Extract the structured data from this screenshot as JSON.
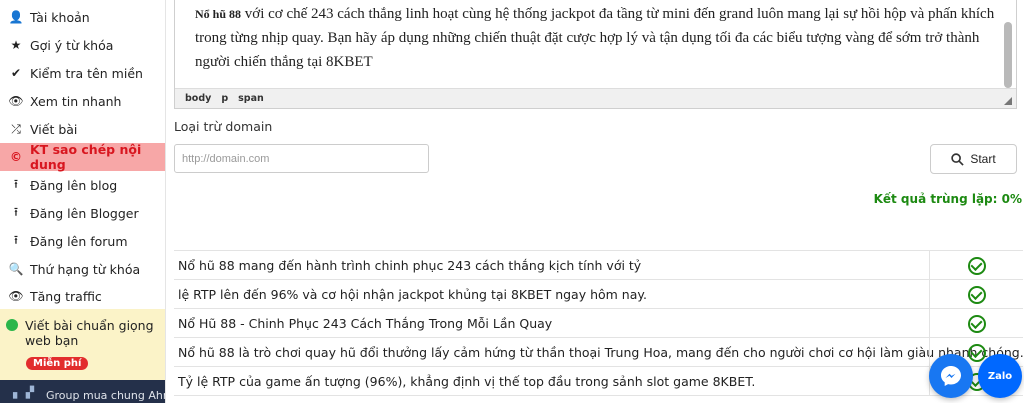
{
  "sidebar": {
    "items": [
      {
        "label": "Tài khoản",
        "icon": "user-icon",
        "glyph": "👤"
      },
      {
        "label": "Gợi ý từ khóa",
        "icon": "star-icon",
        "glyph": "★"
      },
      {
        "label": "Kiểm tra tên miền",
        "icon": "check-icon",
        "glyph": "✔"
      },
      {
        "label": "Xem tin nhanh",
        "icon": "eye-icon",
        "glyph": "👁"
      },
      {
        "label": "Viết bài",
        "icon": "shuffle-icon",
        "glyph": "⤮"
      },
      {
        "label": "KT sao chép nội dung",
        "icon": "copyright-icon",
        "glyph": "©"
      },
      {
        "label": "Đăng lên blog",
        "icon": "upload-icon",
        "glyph": "⭱"
      },
      {
        "label": "Đăng lên Blogger",
        "icon": "upload-icon",
        "glyph": "⭱"
      },
      {
        "label": "Đăng lên forum",
        "icon": "upload-icon",
        "glyph": "⭱"
      },
      {
        "label": "Thứ hạng từ khóa",
        "icon": "search-icon",
        "glyph": "🔍"
      },
      {
        "label": "Tăng traffic",
        "icon": "eye-icon",
        "glyph": "👁"
      }
    ],
    "promo": {
      "text": "Viết bài chuẩn giọng web bạn",
      "badge": "Miễn phí"
    },
    "group_text": "Group mua chung Ahre"
  },
  "editor": {
    "bold_lead": "Nổ hũ 88",
    "body": " với cơ chế 243 cách thắng linh hoạt cùng hệ thống jackpot đa tầng từ mini đến grand luôn mang lại sự hồi hộp và phấn khích trong từng nhịp quay. Bạn hãy áp dụng những chiến thuật đặt cược hợp lý và tận dụng tối đa các biểu tượng vàng để sớm trở thành người chiến thắng tại 8KBET",
    "status_path": [
      "body",
      "p",
      "span"
    ]
  },
  "exclude": {
    "label": "Loại trừ domain",
    "placeholder": "http://domain.com"
  },
  "start_button": {
    "label": "Start"
  },
  "result": {
    "label": "Kết quả trùng lặp: 0%"
  },
  "rows": [
    "Nổ hũ 88 mang đến hành trình chinh phục 243 cách thắng kịch tính với tỷ",
    "lệ RTP lên đến 96% và cơ hội nhận jackpot khủng tại 8KBET ngay hôm nay.",
    "Nổ Hũ 88 - Chinh Phục 243 Cách Thắng Trong Mỗi Lần Quay",
    "Nổ hũ 88 là trò chơi quay hũ đổi thưởng lấy cảm hứng từ thần thoại Trung Hoa, mang đến cho người chơi cơ hội làm giàu nhanh chóng.",
    "Tỷ lệ RTP của game ấn tượng (96%), khẳng định vị thế top đầu trong sảnh slot game 8KBET."
  ],
  "colors": {
    "active_bg": "#f7a7a7",
    "active_text": "#d8161f",
    "success": "#1d8a12",
    "messenger": "#1877f2",
    "zalo": "#0068ff"
  },
  "zalo_label": "Zalo"
}
